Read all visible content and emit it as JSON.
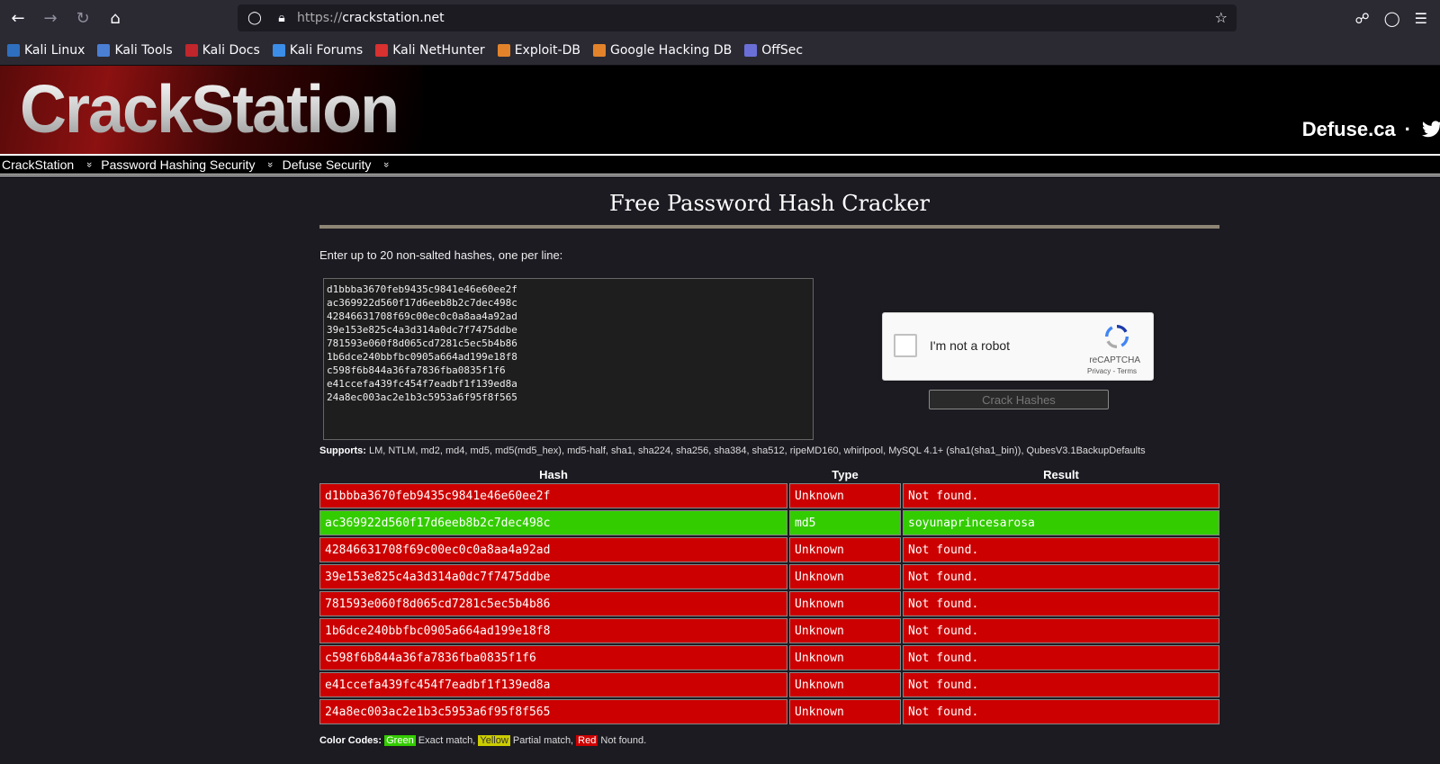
{
  "browser": {
    "url_prefix": "https://",
    "url_host": "crackstation.net",
    "bookmarks": [
      {
        "label": "Kali Linux",
        "color": "#2f6fbf"
      },
      {
        "label": "Kali Tools",
        "color": "#4a7fd4"
      },
      {
        "label": "Kali Docs",
        "color": "#c0262b"
      },
      {
        "label": "Kali Forums",
        "color": "#3c8de8"
      },
      {
        "label": "Kali NetHunter",
        "color": "#d93030"
      },
      {
        "label": "Exploit-DB",
        "color": "#e2832b"
      },
      {
        "label": "Google Hacking DB",
        "color": "#e2832b"
      },
      {
        "label": "OffSec",
        "color": "#6a6fd8"
      }
    ]
  },
  "header": {
    "logo": "CrackStation",
    "defuse": "Defuse.ca",
    "separator": "·"
  },
  "menu": {
    "items": [
      "CrackStation",
      "Password Hashing Security",
      "Defuse Security"
    ]
  },
  "main": {
    "title": "Free Password Hash Cracker",
    "instruction": "Enter up to 20 non-salted hashes, one per line:",
    "textarea_value": "d1bbba3670feb9435c9841e46e60ee2f\nac369922d560f17d6eeb8b2c7dec498c\n42846631708f69c00ec0c0a8aa4a92ad\n39e153e825c4a3d314a0dc7f7475ddbe\n781593e060f8d065cd7281c5ec5b4b86\n1b6dce240bbfbc0905a664ad199e18f8\nc598f6b844a36fa7836fba0835f1f6\ne41ccefa439fc454f7eadbf1f139ed8a\n24a8ec003ac2e1b3c5953a6f95f8f565",
    "captcha_label": "I'm not a robot",
    "captcha_brand": "reCAPTCHA",
    "captcha_links": "Privacy - Terms",
    "crack_button": "Crack Hashes",
    "supports_label": "Supports:",
    "supports_text": " LM, NTLM, md2, md4, md5, md5(md5_hex), md5-half, sha1, sha224, sha256, sha384, sha512, ripeMD160, whirlpool, MySQL 4.1+ (sha1(sha1_bin)), QubesV3.1BackupDefaults"
  },
  "results": {
    "headers": [
      "Hash",
      "Type",
      "Result"
    ],
    "rows": [
      {
        "hash": "d1bbba3670feb9435c9841e46e60ee2f",
        "type": "Unknown",
        "result": "Not found.",
        "status": "notfound"
      },
      {
        "hash": "ac369922d560f17d6eeb8b2c7dec498c",
        "type": "md5",
        "result": "soyunaprincesarosa",
        "status": "found"
      },
      {
        "hash": "42846631708f69c00ec0c0a8aa4a92ad",
        "type": "Unknown",
        "result": "Not found.",
        "status": "notfound"
      },
      {
        "hash": "39e153e825c4a3d314a0dc7f7475ddbe",
        "type": "Unknown",
        "result": "Not found.",
        "status": "notfound"
      },
      {
        "hash": "781593e060f8d065cd7281c5ec5b4b86",
        "type": "Unknown",
        "result": "Not found.",
        "status": "notfound"
      },
      {
        "hash": "1b6dce240bbfbc0905a664ad199e18f8",
        "type": "Unknown",
        "result": "Not found.",
        "status": "notfound"
      },
      {
        "hash": "c598f6b844a36fa7836fba0835f1f6",
        "type": "Unknown",
        "result": "Not found.",
        "status": "notfound"
      },
      {
        "hash": "e41ccefa439fc454f7eadbf1f139ed8a",
        "type": "Unknown",
        "result": "Not found.",
        "status": "notfound"
      },
      {
        "hash": "24a8ec003ac2e1b3c5953a6f95f8f565",
        "type": "Unknown",
        "result": "Not found.",
        "status": "notfound"
      }
    ]
  },
  "color_codes": {
    "label": "Color Codes:",
    "green": "Green",
    "green_desc": " Exact match, ",
    "yellow": "Yellow",
    "yellow_desc": " Partial match, ",
    "red": "Red",
    "red_desc": " Not found."
  }
}
